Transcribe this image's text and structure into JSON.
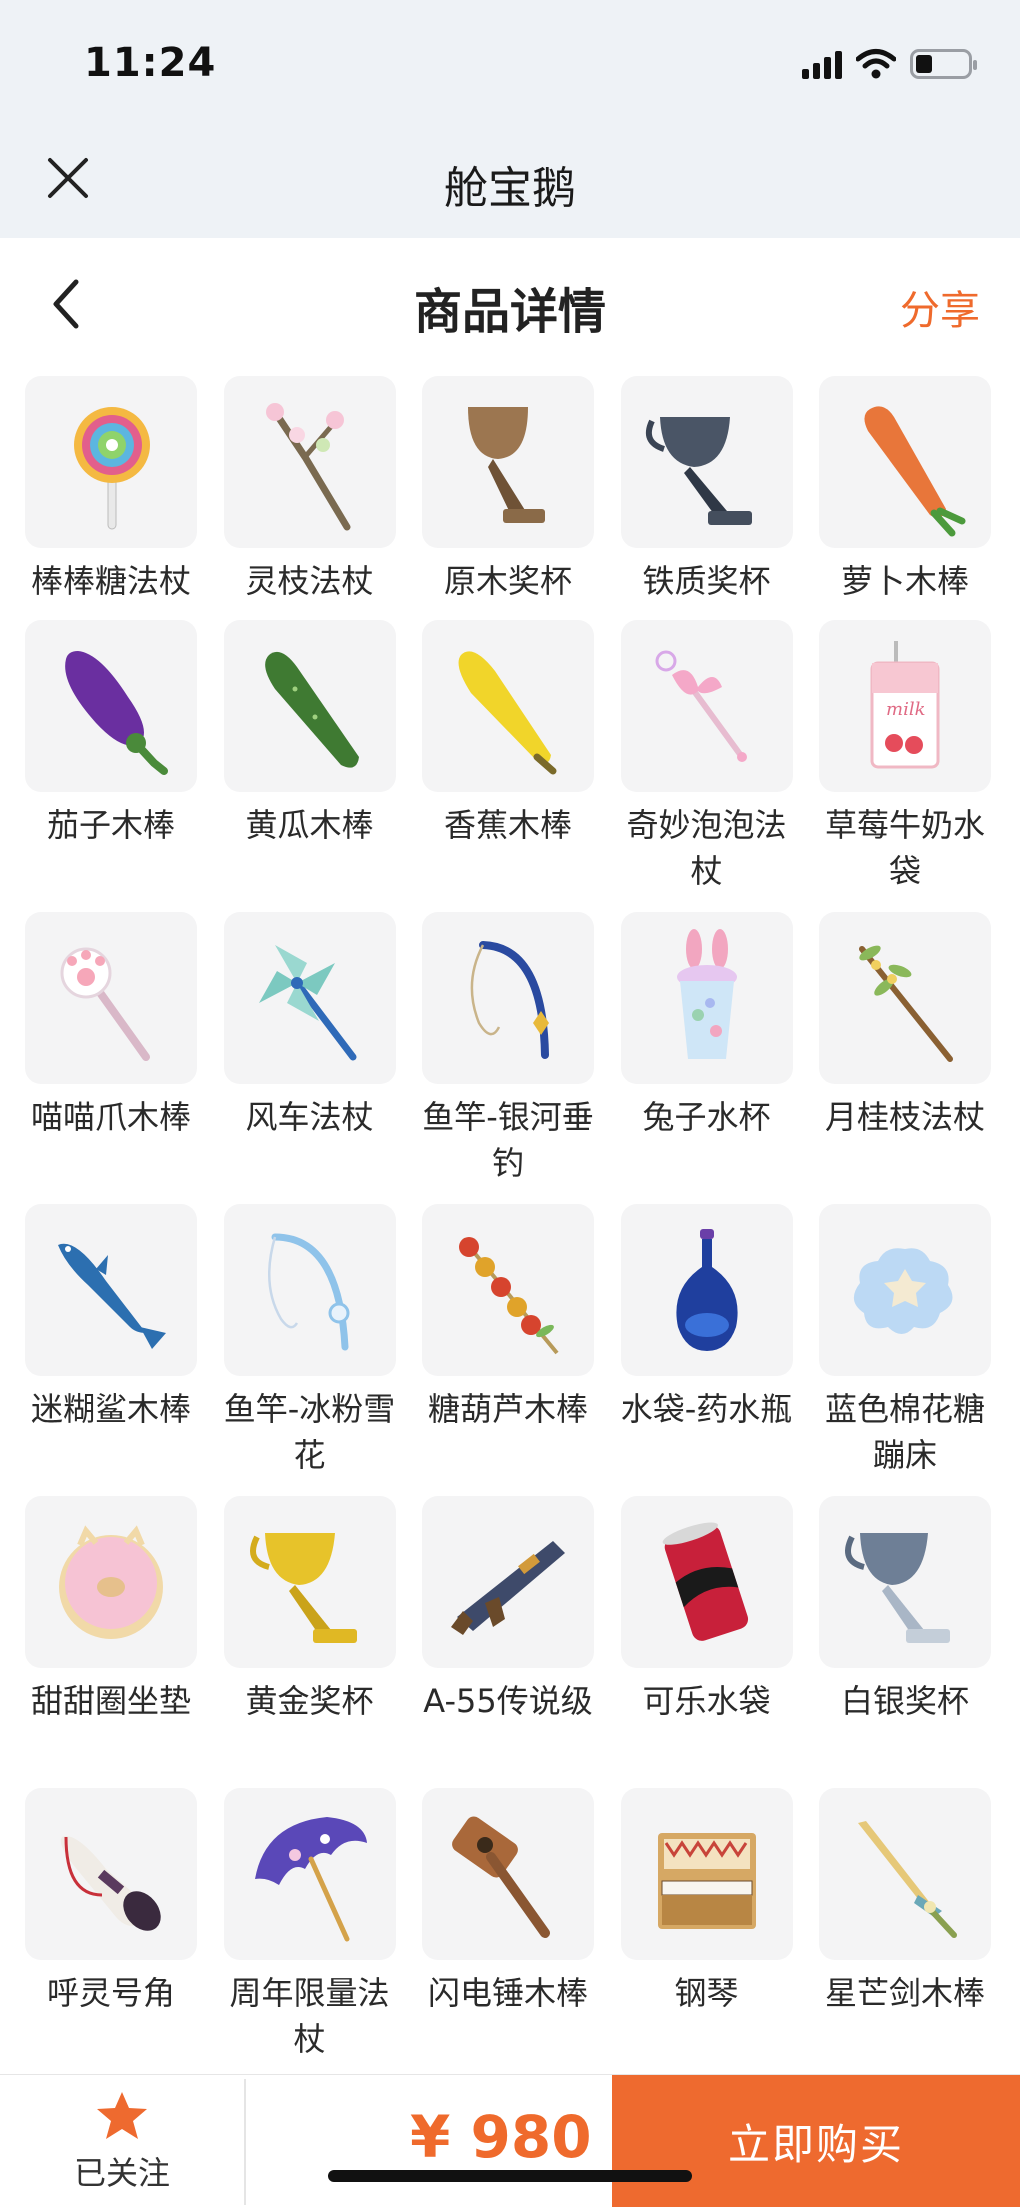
{
  "status_bar": {
    "time": "11:24"
  },
  "header": {
    "app_title": "舱宝鹅"
  },
  "page": {
    "title": "商品详情",
    "share_label": "分享"
  },
  "items": [
    {
      "name": "棒棒糖法杖",
      "icon": "lollipop-wand-icon"
    },
    {
      "name": "灵枝法杖",
      "icon": "blossom-branch-wand-icon"
    },
    {
      "name": "原木奖杯",
      "icon": "wooden-trophy-icon"
    },
    {
      "name": "铁质奖杯",
      "icon": "iron-trophy-icon"
    },
    {
      "name": "萝卜木棒",
      "icon": "carrot-club-icon"
    },
    {
      "name": "茄子木棒",
      "icon": "eggplant-club-icon"
    },
    {
      "name": "黄瓜木棒",
      "icon": "cucumber-club-icon"
    },
    {
      "name": "香蕉木棒",
      "icon": "banana-club-icon"
    },
    {
      "name": "奇妙泡泡法杖",
      "icon": "bubble-wand-icon"
    },
    {
      "name": "草莓牛奶水袋",
      "icon": "strawberry-milk-bag-icon",
      "label": "milk"
    },
    {
      "name": "喵喵爪木棒",
      "icon": "cat-paw-club-icon"
    },
    {
      "name": "风车法杖",
      "icon": "pinwheel-wand-icon"
    },
    {
      "name": "鱼竿-银河垂钓",
      "icon": "fishing-rod-galaxy-icon"
    },
    {
      "name": "兔子水杯",
      "icon": "bunny-cup-icon"
    },
    {
      "name": "月桂枝法杖",
      "icon": "laurel-branch-wand-icon"
    },
    {
      "name": "迷糊鲨木棒",
      "icon": "shark-club-icon"
    },
    {
      "name": "鱼竿-冰粉雪花",
      "icon": "fishing-rod-snowflake-icon"
    },
    {
      "name": "糖葫芦木棒",
      "icon": "candied-haws-club-icon"
    },
    {
      "name": "水袋-药水瓶",
      "icon": "potion-bottle-icon"
    },
    {
      "name": "蓝色棉花糖蹦床",
      "icon": "marshmallow-trampoline-icon"
    },
    {
      "name": "甜甜圈坐垫",
      "icon": "donut-cushion-icon"
    },
    {
      "name": "黄金奖杯",
      "icon": "gold-trophy-icon"
    },
    {
      "name": "A-55传说级",
      "icon": "a55-rifle-icon"
    },
    {
      "name": "可乐水袋",
      "icon": "cola-can-icon"
    },
    {
      "name": "白银奖杯",
      "icon": "silver-trophy-icon"
    },
    {
      "name": "呼灵号角",
      "icon": "horn-icon"
    },
    {
      "name": "周年限量法杖",
      "icon": "anniversary-umbrella-icon"
    },
    {
      "name": "闪电锤木棒",
      "icon": "lightning-hammer-icon"
    },
    {
      "name": "钢琴",
      "icon": "piano-icon"
    },
    {
      "name": "星芒剑木棒",
      "icon": "star-sword-icon"
    }
  ],
  "bottom_bar": {
    "follow_label": "已关注",
    "price": "¥ 980",
    "buy_label": "立即购买"
  },
  "colors": {
    "accent": "#ee6a2f",
    "thumb_bg": "#f4f4f5",
    "header_bg": "#eef2f6"
  }
}
